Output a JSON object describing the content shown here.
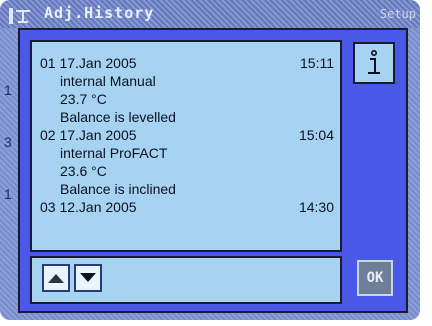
{
  "header": {
    "title": "Adj.History",
    "right_label": "Setup"
  },
  "background": {
    "side_marks": [
      "1",
      "3",
      "1"
    ]
  },
  "dialog": {
    "entries": [
      {
        "index": "01",
        "date": "17.Jan 2005",
        "time": "15:11",
        "type": "internal Manual",
        "temperature": "23.7 °C",
        "status": "Balance is levelled"
      },
      {
        "index": "02",
        "date": "17.Jan 2005",
        "time": "15:04",
        "type": "internal ProFACT",
        "temperature": "23.6 °C",
        "status": "Balance is inclined"
      },
      {
        "index": "03",
        "date": "12.Jan 2005",
        "time": "14:30"
      }
    ],
    "info_icon": "info-icon",
    "ok_label": "OK",
    "scroll_up_icon": "arrow-up-icon",
    "scroll_down_icon": "arrow-down-icon"
  },
  "colors": {
    "screen_bg": "#7f94d4",
    "dialog_frame": "#4a58e8",
    "panel_bg": "#a6d3f2"
  }
}
